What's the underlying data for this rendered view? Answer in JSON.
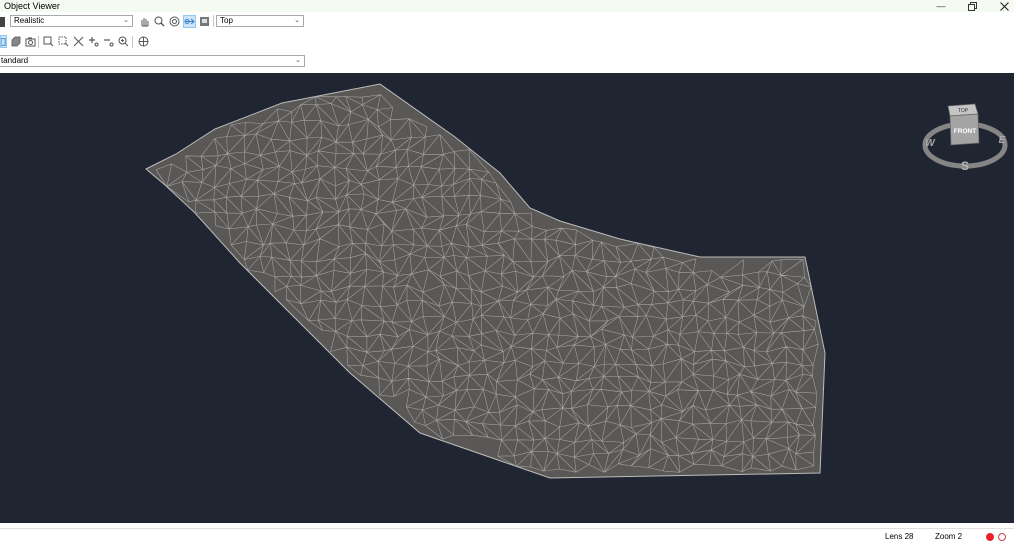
{
  "window": {
    "title": "Object Viewer",
    "minimize_icon": "minimize-icon",
    "restore_icon": "restore-icon",
    "close_icon": "close-icon"
  },
  "toolbar": {
    "visual_style": "Realistic",
    "view": "Top",
    "view_type": "tandard",
    "row1_icons": [
      "pan-icon",
      "zoom-icon",
      "orbit-icon",
      "free-orbit-icon",
      "view-icon"
    ],
    "row2_icons": [
      "viewport-icon",
      "shade-icon",
      "camera-icon",
      "zoom-window-icon",
      "zoom-extents-icon",
      "zoom-all-icon",
      "zoom-in-icon",
      "zoom-out-icon",
      "zoom-realtime-icon",
      "steering-wheel-icon"
    ]
  },
  "viewcube": {
    "top_label": "TOP",
    "front_label": "FRONT",
    "north": "",
    "west": "W",
    "east": "E",
    "south": "S"
  },
  "status": {
    "lens": "Lens 28",
    "zoom": "Zoom 2"
  },
  "colors": {
    "viewport_bg": "#1f2631",
    "mesh_fill": "#5a5856",
    "mesh_line": "#a7a6a4",
    "titlebar_bg": "#f6fbf1",
    "status_red": "#e8212b"
  }
}
